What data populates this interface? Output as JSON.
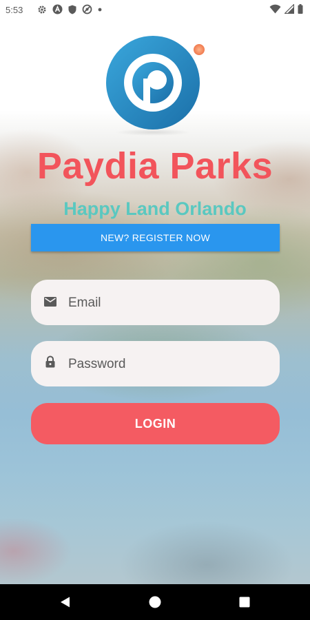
{
  "status_bar": {
    "time": "5:53",
    "left_icons": [
      "gear-icon",
      "a-circle-icon",
      "shield-icon",
      "no-sync-icon",
      "dot-icon"
    ],
    "right_icons": [
      "wifi-icon",
      "signal-icon",
      "battery-icon"
    ]
  },
  "app": {
    "title": "Paydia Parks",
    "subtitle": "Happy Land Orlando",
    "colors": {
      "title": "#f2545b",
      "subtitle": "#5ac8c0",
      "register_button": "#2a96ee",
      "login_button": "#f45b62",
      "logo_blue": "#1e88c4",
      "logo_dot": "#f28a5e"
    }
  },
  "register": {
    "label": "NEW? REGISTER NOW"
  },
  "form": {
    "email": {
      "placeholder": "Email",
      "value": "",
      "icon": "mail-icon"
    },
    "password": {
      "placeholder": "Password",
      "value": "",
      "icon": "lock-icon"
    }
  },
  "login": {
    "label": "LOGIN"
  },
  "nav_bar": {
    "buttons": [
      "back-icon",
      "home-icon",
      "recents-icon"
    ]
  }
}
